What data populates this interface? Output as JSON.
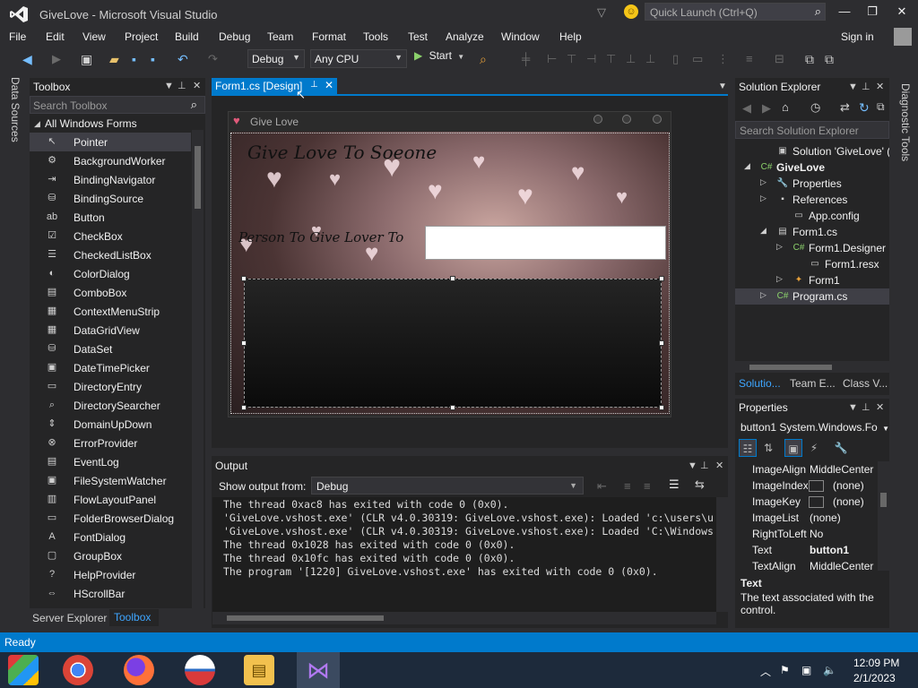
{
  "window": {
    "title": "GiveLove - Microsoft Visual Studio",
    "quick_launch_placeholder": "Quick Launch (Ctrl+Q)",
    "minimize": "—",
    "maximize": "❐",
    "close": "✕"
  },
  "menu": [
    "File",
    "Edit",
    "View",
    "Project",
    "Build",
    "Debug",
    "Team",
    "Format",
    "Tools",
    "Test",
    "Analyze",
    "Window",
    "Help"
  ],
  "signin": "Sign in",
  "toolbar": {
    "config": "Debug",
    "platform": "Any CPU",
    "start": "Start"
  },
  "left_vertical_tab": "Data Sources",
  "right_vertical_tab": "Diagnostic Tools",
  "toolbox": {
    "title": "Toolbox",
    "search_placeholder": "Search Toolbox",
    "group": "All Windows Forms",
    "items": [
      {
        "label": "Pointer",
        "icon": "pointer-icon",
        "glyph": "↖"
      },
      {
        "label": "BackgroundWorker",
        "icon": "backgroundworker-icon",
        "glyph": "⚙"
      },
      {
        "label": "BindingNavigator",
        "icon": "bindingnavigator-icon",
        "glyph": "⇥"
      },
      {
        "label": "BindingSource",
        "icon": "bindingsource-icon",
        "glyph": "⛁"
      },
      {
        "label": "Button",
        "icon": "button-icon",
        "glyph": "ab"
      },
      {
        "label": "CheckBox",
        "icon": "checkbox-icon",
        "glyph": "☑"
      },
      {
        "label": "CheckedListBox",
        "icon": "checkedlistbox-icon",
        "glyph": "☰"
      },
      {
        "label": "ColorDialog",
        "icon": "colordialog-icon",
        "glyph": "◐"
      },
      {
        "label": "ComboBox",
        "icon": "combobox-icon",
        "glyph": "▤"
      },
      {
        "label": "ContextMenuStrip",
        "icon": "contextmenustrip-icon",
        "glyph": "▦"
      },
      {
        "label": "DataGridView",
        "icon": "datagridview-icon",
        "glyph": "▦"
      },
      {
        "label": "DataSet",
        "icon": "dataset-icon",
        "glyph": "⛁"
      },
      {
        "label": "DateTimePicker",
        "icon": "datetimepicker-icon",
        "glyph": "▣"
      },
      {
        "label": "DirectoryEntry",
        "icon": "directoryentry-icon",
        "glyph": "▭"
      },
      {
        "label": "DirectorySearcher",
        "icon": "directorysearcher-icon",
        "glyph": "⌕"
      },
      {
        "label": "DomainUpDown",
        "icon": "domainupdown-icon",
        "glyph": "⇕"
      },
      {
        "label": "ErrorProvider",
        "icon": "errorprovider-icon",
        "glyph": "⊗"
      },
      {
        "label": "EventLog",
        "icon": "eventlog-icon",
        "glyph": "▤"
      },
      {
        "label": "FileSystemWatcher",
        "icon": "filesystemwatcher-icon",
        "glyph": "▣"
      },
      {
        "label": "FlowLayoutPanel",
        "icon": "flowlayoutpanel-icon",
        "glyph": "▥"
      },
      {
        "label": "FolderBrowserDialog",
        "icon": "folderbrowserdialog-icon",
        "glyph": "▭"
      },
      {
        "label": "FontDialog",
        "icon": "fontdialog-icon",
        "glyph": "A"
      },
      {
        "label": "GroupBox",
        "icon": "groupbox-icon",
        "glyph": "▢"
      },
      {
        "label": "HelpProvider",
        "icon": "helpprovider-icon",
        "glyph": "?"
      },
      {
        "label": "HScrollBar",
        "icon": "hscrollbar-icon",
        "glyph": "⇔"
      }
    ]
  },
  "bottom_left_tabs": {
    "server_explorer": "Server Explorer",
    "toolbox": "Toolbox"
  },
  "designer": {
    "tab_label": "Form1.cs [Design]",
    "form_title": "Give Love",
    "heading": "Give Love To Soeone",
    "label": "Person To Give Lover To"
  },
  "output": {
    "title": "Output",
    "show_from_label": "Show output from:",
    "show_from_value": "Debug",
    "lines": [
      "The thread 0xac8 has exited with code 0 (0x0).",
      "'GiveLove.vshost.exe' (CLR v4.0.30319: GiveLove.vshost.exe): Loaded 'c:\\users\\u",
      "'GiveLove.vshost.exe' (CLR v4.0.30319: GiveLove.vshost.exe): Loaded 'C:\\Windows",
      "The thread 0x1028 has exited with code 0 (0x0).",
      "The thread 0x10fc has exited with code 0 (0x0).",
      "The program '[1220] GiveLove.vshost.exe' has exited with code 0 (0x0)."
    ]
  },
  "solution_explorer": {
    "title": "Solution Explorer",
    "search_placeholder": "Search Solution Explorer",
    "items": [
      {
        "label": "Solution 'GiveLove' (1 proj",
        "icon": "solution-icon",
        "glyph": "▣",
        "color": "#c8c8c8",
        "expander": ""
      },
      {
        "label": "GiveLove",
        "icon": "csharp-project-icon",
        "glyph": "C#",
        "color": "#8bd16b",
        "expander": "◢",
        "bold": true
      },
      {
        "label": "Properties",
        "icon": "properties-wrench-icon",
        "glyph": "🔧",
        "color": "#d0d0d0",
        "expander": "▷"
      },
      {
        "label": "References",
        "icon": "references-icon",
        "glyph": "▪",
        "color": "#d0d0d0",
        "expander": "▷"
      },
      {
        "label": "App.config",
        "icon": "config-file-icon",
        "glyph": "▭",
        "color": "#d0d0d0",
        "expander": ""
      },
      {
        "label": "Form1.cs",
        "icon": "form-icon",
        "glyph": "▤",
        "color": "#d0d0d0",
        "expander": "◢"
      },
      {
        "label": "Form1.Designer",
        "icon": "csharp-file-icon",
        "glyph": "C#",
        "color": "#8bd16b",
        "expander": "▷"
      },
      {
        "label": "Form1.resx",
        "icon": "resx-file-icon",
        "glyph": "▭",
        "color": "#d0d0d0",
        "expander": ""
      },
      {
        "label": "Form1",
        "icon": "class-icon",
        "glyph": "✦",
        "color": "#e8a13a",
        "expander": "▷"
      },
      {
        "label": "Program.cs",
        "icon": "csharp-file-icon",
        "glyph": "C#",
        "color": "#8bd16b",
        "expander": "▷"
      }
    ],
    "tabs": [
      "Solutio...",
      "Team E...",
      "Class V..."
    ]
  },
  "properties": {
    "title": "Properties",
    "object": "button1  System.Windows.Fo",
    "rows": [
      {
        "name": "ImageAlign",
        "value": "MiddleCenter",
        "swatch": false
      },
      {
        "name": "ImageIndex",
        "value": "(none)",
        "swatch": true
      },
      {
        "name": "ImageKey",
        "value": "(none)",
        "swatch": true
      },
      {
        "name": "ImageList",
        "value": "(none)",
        "swatch": false
      },
      {
        "name": "RightToLeft",
        "value": "No",
        "swatch": false
      },
      {
        "name": "Text",
        "value": "button1",
        "swatch": false,
        "bold": true
      },
      {
        "name": "TextAlign",
        "value": "MiddleCenter",
        "swatch": false
      }
    ],
    "desc_title": "Text",
    "desc": "The text associated with the control."
  },
  "status": "Ready",
  "taskbar": {
    "time": "12:09 PM",
    "date": "2/1/2023",
    "apps": [
      "start-icon",
      "chrome-icon",
      "firefox-icon",
      "obama-logo-icon",
      "file-explorer-icon",
      "visual-studio-icon"
    ]
  },
  "colors": {
    "accent": "#007acc",
    "background": "#2d2d30",
    "panel": "#252526"
  }
}
